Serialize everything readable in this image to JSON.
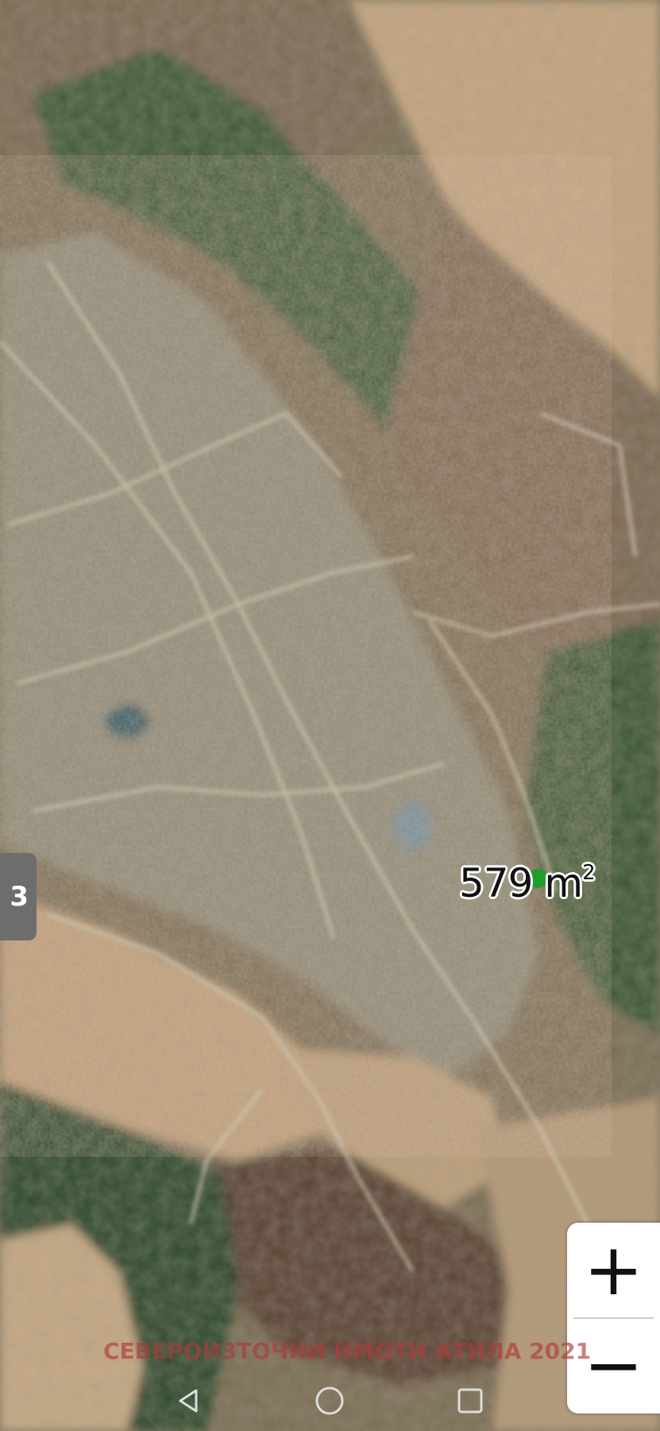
{
  "map": {
    "view": "satellite",
    "area_value": "579",
    "area_unit": "m",
    "area_superscript": "2",
    "marker_color": "#1e9e2e",
    "watermark_text": "СЕВЕРОИЗТОЧНИ ИМОТИ АТИЛА 2021",
    "side_tab_text": "3"
  },
  "controls": {
    "zoom_in_label": "+",
    "zoom_out_label": "−"
  },
  "navbar": {
    "back_icon": "triangle-back-icon",
    "home_icon": "circle-home-icon",
    "recents_icon": "square-recents-icon"
  },
  "colors": {
    "field": "#c6a680",
    "forest": "#3d5c3a",
    "village": "#8c8a78",
    "road": "#c9c3ae"
  }
}
